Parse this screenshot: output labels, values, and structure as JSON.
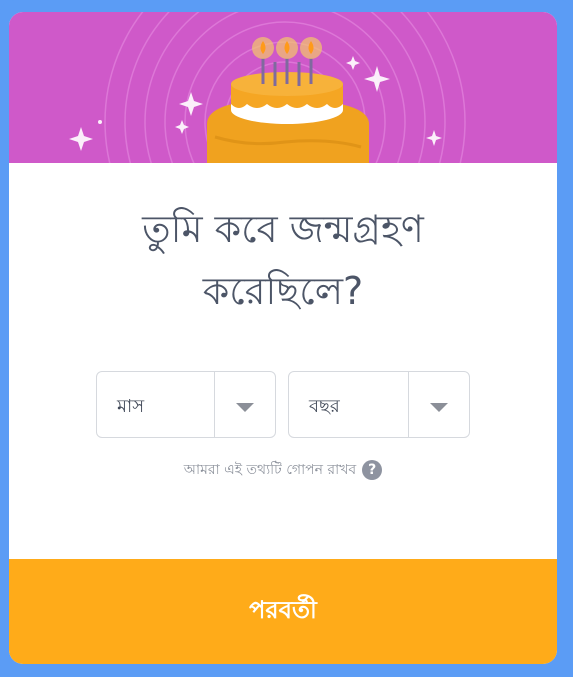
{
  "dialog": {
    "title_line1": "তুমি কবে জন্মগ্রহণ",
    "title_line2": "করেছিলে?",
    "month_select": {
      "label": "মাস",
      "icon": "chevron-down-icon"
    },
    "year_select": {
      "label": "বছর",
      "icon": "chevron-down-icon"
    },
    "privacy_note": "আমরা এই তথ্যটি গোপন রাখব",
    "help_icon": "?",
    "next_button": "পরবর্তী"
  },
  "colors": {
    "frame_border": "#5b9cf5",
    "banner_bg": "#cf59c9",
    "cake_orange": "#f5a623",
    "button_bg": "#ffab19",
    "title_text": "#4c5567"
  }
}
